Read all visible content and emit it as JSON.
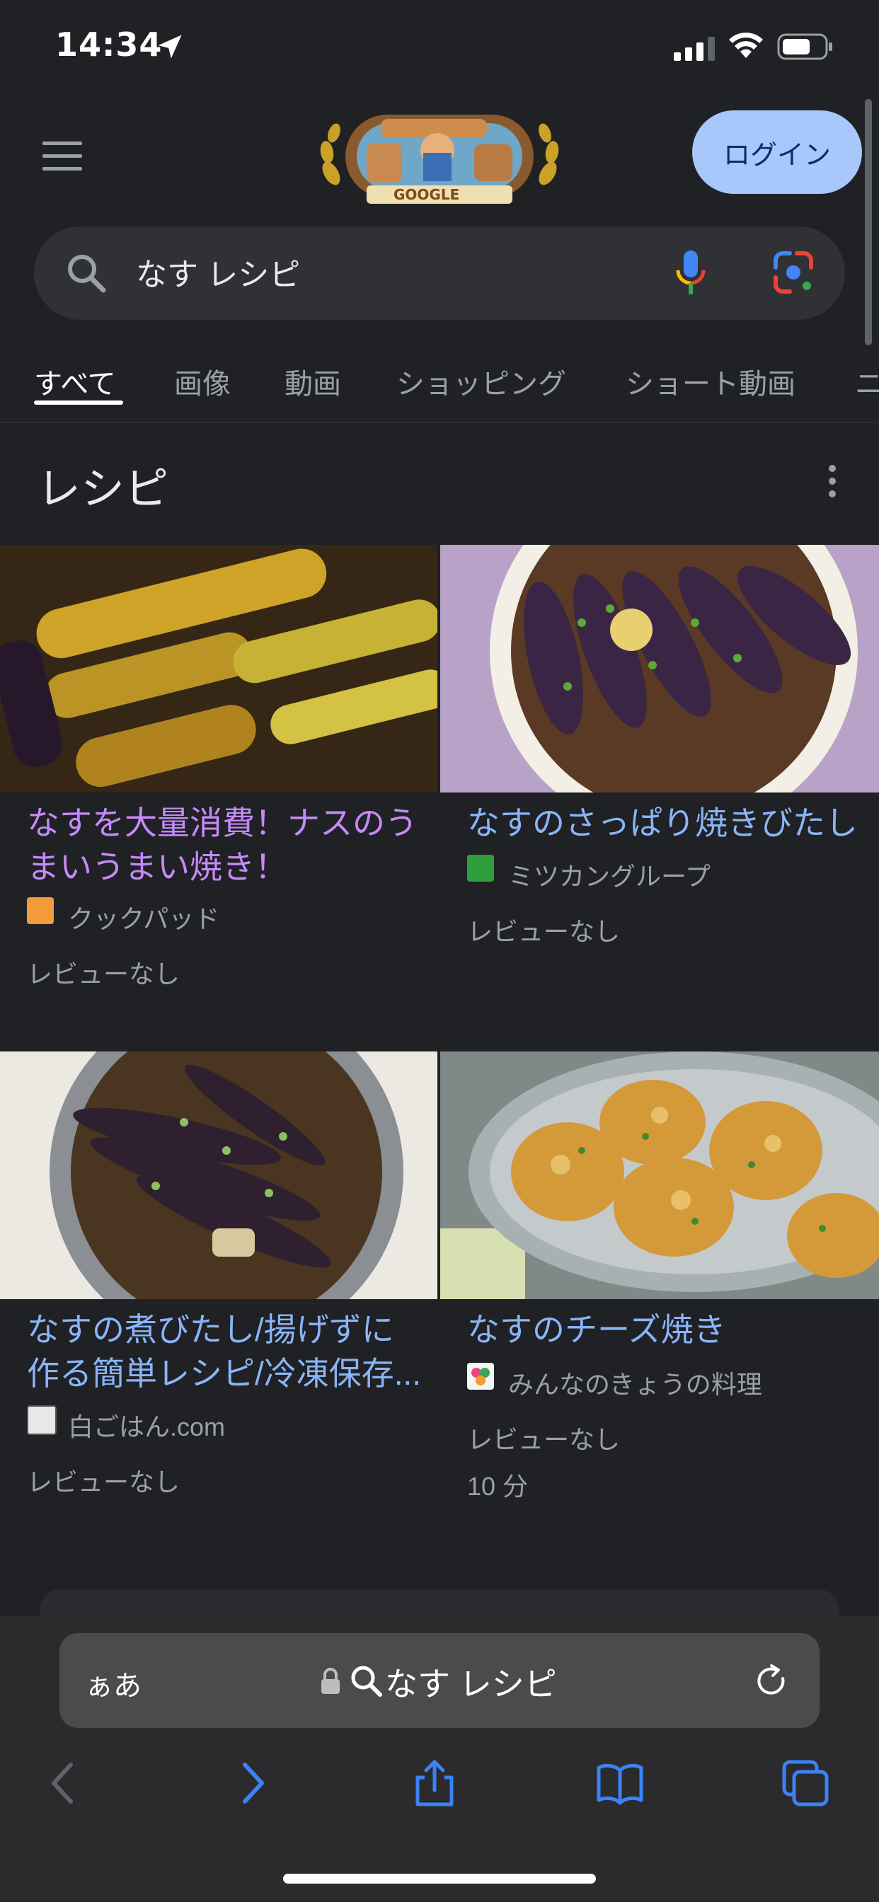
{
  "status_bar": {
    "time": "14:34"
  },
  "header": {
    "login_label": "ログイン"
  },
  "search": {
    "query": "なす レシピ"
  },
  "tabs": [
    {
      "label": "すべて"
    },
    {
      "label": "画像"
    },
    {
      "label": "動画"
    },
    {
      "label": "ショッピング"
    },
    {
      "label": "ショート動画"
    },
    {
      "label": "ニ"
    }
  ],
  "recipes_section": {
    "title": "レシピ",
    "cards": [
      {
        "title_line1": "なすを大量消費！ナスのう",
        "title_line2": "まいうまい焼き！",
        "source": "クックパッド",
        "review": "レビューなし",
        "time": ""
      },
      {
        "title_line1": "なすのさっぱり焼きびたし",
        "title_line2": "",
        "source": "ミツカングループ",
        "review": "レビューなし",
        "time": ""
      },
      {
        "title_line1": "なすの煮びたし/揚げずに",
        "title_line2": "作る簡単レシピ/冷凍保存...",
        "source": "白ごはん.com",
        "review": "レビューなし",
        "time": ""
      },
      {
        "title_line1": "なすのチーズ焼き",
        "title_line2": "",
        "source": "みんなのきょうの料理",
        "review": "レビューなし",
        "time": "10 分"
      }
    ]
  },
  "browser": {
    "aa_label": "ぁあ",
    "address_text": "なす レシピ"
  },
  "colors": {
    "background": "#202124",
    "link": "#8ab4f8",
    "visited_link": "#c58af9",
    "login_button": "#a8c7fa"
  }
}
